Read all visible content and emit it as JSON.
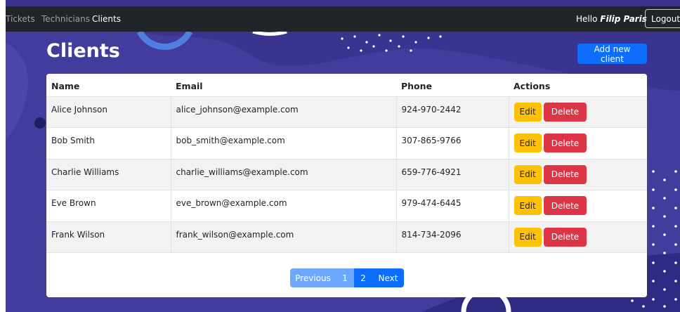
{
  "navbar": {
    "links": [
      {
        "label": "Tickets",
        "active": false
      },
      {
        "label": "Technicians",
        "active": false
      },
      {
        "label": "Clients",
        "active": true
      }
    ],
    "greeting": "Hello",
    "username": "Filip Paris",
    "logout_label": "Logout"
  },
  "page": {
    "title": "Clients",
    "add_button_label": "Add new client"
  },
  "table": {
    "headers": [
      "Name",
      "Email",
      "Phone",
      "Actions"
    ],
    "rows": [
      {
        "name": "Alice Johnson",
        "email": "alice_johnson@example.com",
        "phone": "924-970-2442"
      },
      {
        "name": "Bob Smith",
        "email": "bob_smith@example.com",
        "phone": "307-865-9766"
      },
      {
        "name": "Charlie Williams",
        "email": "charlie_williams@example.com",
        "phone": "659-776-4921"
      },
      {
        "name": "Eve Brown",
        "email": "eve_brown@example.com",
        "phone": "979-474-6445"
      },
      {
        "name": "Frank Wilson",
        "email": "frank_wilson@example.com",
        "phone": "814-734-2096"
      }
    ],
    "edit_label": "Edit",
    "delete_label": "Delete"
  },
  "pagination": {
    "previous_label": "Previous",
    "pages": [
      "1",
      "2"
    ],
    "current_page": "1",
    "next_label": "Next"
  },
  "colors": {
    "navbar_bg": "#212529",
    "background": "#3a338f",
    "primary": "#0d6efd",
    "warning": "#ffc107",
    "danger": "#dc3545"
  }
}
